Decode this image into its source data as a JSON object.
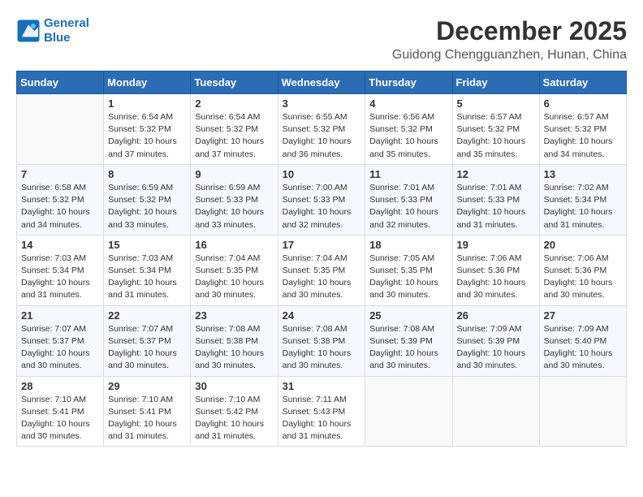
{
  "header": {
    "logo_line1": "General",
    "logo_line2": "Blue",
    "month_title": "December 2025",
    "location": "Guidong Chengguanzhen, Hunan, China"
  },
  "weekdays": [
    "Sunday",
    "Monday",
    "Tuesday",
    "Wednesday",
    "Thursday",
    "Friday",
    "Saturday"
  ],
  "weeks": [
    [
      {
        "day": "",
        "info": ""
      },
      {
        "day": "1",
        "info": "Sunrise: 6:54 AM\nSunset: 5:32 PM\nDaylight: 10 hours\nand 37 minutes."
      },
      {
        "day": "2",
        "info": "Sunrise: 6:54 AM\nSunset: 5:32 PM\nDaylight: 10 hours\nand 37 minutes."
      },
      {
        "day": "3",
        "info": "Sunrise: 6:55 AM\nSunset: 5:32 PM\nDaylight: 10 hours\nand 36 minutes."
      },
      {
        "day": "4",
        "info": "Sunrise: 6:56 AM\nSunset: 5:32 PM\nDaylight: 10 hours\nand 35 minutes."
      },
      {
        "day": "5",
        "info": "Sunrise: 6:57 AM\nSunset: 5:32 PM\nDaylight: 10 hours\nand 35 minutes."
      },
      {
        "day": "6",
        "info": "Sunrise: 6:57 AM\nSunset: 5:32 PM\nDaylight: 10 hours\nand 34 minutes."
      }
    ],
    [
      {
        "day": "7",
        "info": "Sunrise: 6:58 AM\nSunset: 5:32 PM\nDaylight: 10 hours\nand 34 minutes."
      },
      {
        "day": "8",
        "info": "Sunrise: 6:59 AM\nSunset: 5:32 PM\nDaylight: 10 hours\nand 33 minutes."
      },
      {
        "day": "9",
        "info": "Sunrise: 6:59 AM\nSunset: 5:33 PM\nDaylight: 10 hours\nand 33 minutes."
      },
      {
        "day": "10",
        "info": "Sunrise: 7:00 AM\nSunset: 5:33 PM\nDaylight: 10 hours\nand 32 minutes."
      },
      {
        "day": "11",
        "info": "Sunrise: 7:01 AM\nSunset: 5:33 PM\nDaylight: 10 hours\nand 32 minutes."
      },
      {
        "day": "12",
        "info": "Sunrise: 7:01 AM\nSunset: 5:33 PM\nDaylight: 10 hours\nand 31 minutes."
      },
      {
        "day": "13",
        "info": "Sunrise: 7:02 AM\nSunset: 5:34 PM\nDaylight: 10 hours\nand 31 minutes."
      }
    ],
    [
      {
        "day": "14",
        "info": "Sunrise: 7:03 AM\nSunset: 5:34 PM\nDaylight: 10 hours\nand 31 minutes."
      },
      {
        "day": "15",
        "info": "Sunrise: 7:03 AM\nSunset: 5:34 PM\nDaylight: 10 hours\nand 31 minutes."
      },
      {
        "day": "16",
        "info": "Sunrise: 7:04 AM\nSunset: 5:35 PM\nDaylight: 10 hours\nand 30 minutes."
      },
      {
        "day": "17",
        "info": "Sunrise: 7:04 AM\nSunset: 5:35 PM\nDaylight: 10 hours\nand 30 minutes."
      },
      {
        "day": "18",
        "info": "Sunrise: 7:05 AM\nSunset: 5:35 PM\nDaylight: 10 hours\nand 30 minutes."
      },
      {
        "day": "19",
        "info": "Sunrise: 7:06 AM\nSunset: 5:36 PM\nDaylight: 10 hours\nand 30 minutes."
      },
      {
        "day": "20",
        "info": "Sunrise: 7:06 AM\nSunset: 5:36 PM\nDaylight: 10 hours\nand 30 minutes."
      }
    ],
    [
      {
        "day": "21",
        "info": "Sunrise: 7:07 AM\nSunset: 5:37 PM\nDaylight: 10 hours\nand 30 minutes."
      },
      {
        "day": "22",
        "info": "Sunrise: 7:07 AM\nSunset: 5:37 PM\nDaylight: 10 hours\nand 30 minutes."
      },
      {
        "day": "23",
        "info": "Sunrise: 7:08 AM\nSunset: 5:38 PM\nDaylight: 10 hours\nand 30 minutes."
      },
      {
        "day": "24",
        "info": "Sunrise: 7:08 AM\nSunset: 5:38 PM\nDaylight: 10 hours\nand 30 minutes."
      },
      {
        "day": "25",
        "info": "Sunrise: 7:08 AM\nSunset: 5:39 PM\nDaylight: 10 hours\nand 30 minutes."
      },
      {
        "day": "26",
        "info": "Sunrise: 7:09 AM\nSunset: 5:39 PM\nDaylight: 10 hours\nand 30 minutes."
      },
      {
        "day": "27",
        "info": "Sunrise: 7:09 AM\nSunset: 5:40 PM\nDaylight: 10 hours\nand 30 minutes."
      }
    ],
    [
      {
        "day": "28",
        "info": "Sunrise: 7:10 AM\nSunset: 5:41 PM\nDaylight: 10 hours\nand 30 minutes."
      },
      {
        "day": "29",
        "info": "Sunrise: 7:10 AM\nSunset: 5:41 PM\nDaylight: 10 hours\nand 31 minutes."
      },
      {
        "day": "30",
        "info": "Sunrise: 7:10 AM\nSunset: 5:42 PM\nDaylight: 10 hours\nand 31 minutes."
      },
      {
        "day": "31",
        "info": "Sunrise: 7:11 AM\nSunset: 5:43 PM\nDaylight: 10 hours\nand 31 minutes."
      },
      {
        "day": "",
        "info": ""
      },
      {
        "day": "",
        "info": ""
      },
      {
        "day": "",
        "info": ""
      }
    ]
  ]
}
